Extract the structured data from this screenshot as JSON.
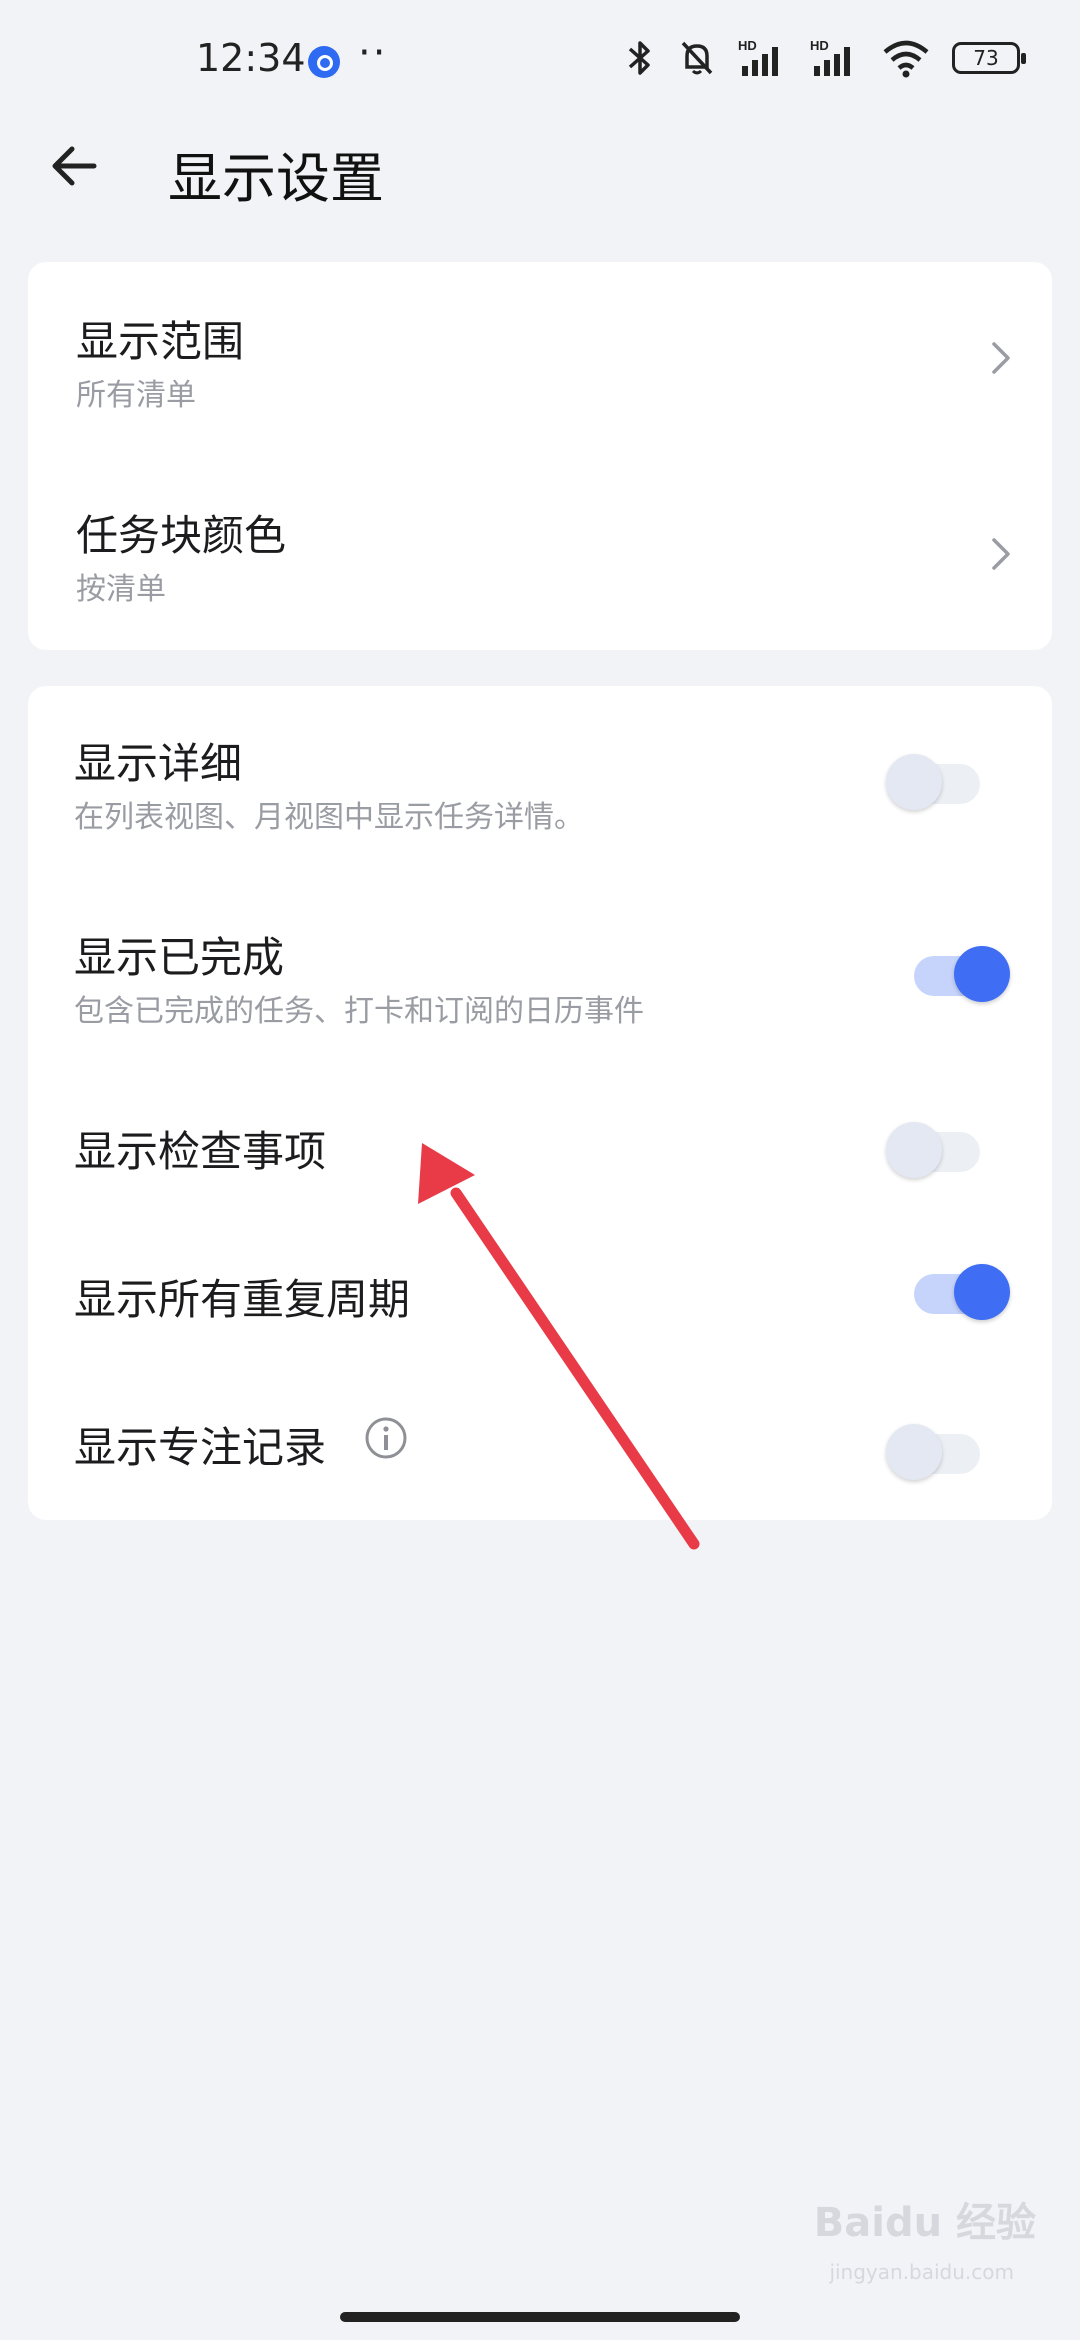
{
  "status_bar": {
    "time": "12:34",
    "more": "··",
    "battery": "73",
    "icons": [
      "bluetooth-icon",
      "mute-bell-icon",
      "signal-hd-icon",
      "signal-hd-icon",
      "wifi-icon",
      "battery-icon"
    ]
  },
  "header": {
    "title": "显示设置",
    "back_icon": "arrow-left-icon"
  },
  "card1": {
    "items": [
      {
        "title": "显示范围",
        "subtitle": "所有清单"
      },
      {
        "title": "任务块颜色",
        "subtitle": "按清单"
      }
    ]
  },
  "card2": {
    "items": [
      {
        "title": "显示详细",
        "subtitle": "在列表视图、月视图中显示任务详情。",
        "enabled": false
      },
      {
        "title": "显示已完成",
        "subtitle": "包含已完成的任务、打卡和订阅的日历事件",
        "enabled": true
      },
      {
        "title": "显示检查事项",
        "enabled": false
      },
      {
        "title": "显示所有重复周期",
        "enabled": true
      },
      {
        "title": "显示专注记录",
        "enabled": false,
        "icon": "info-icon"
      }
    ]
  },
  "annotation": {
    "color": "#e83a47"
  },
  "watermark": {
    "text": "Baidu 经验",
    "sub": "jingyan.baidu.com"
  },
  "colors": {
    "accent": "#3f6ef5",
    "background": "#f2f3f7"
  }
}
